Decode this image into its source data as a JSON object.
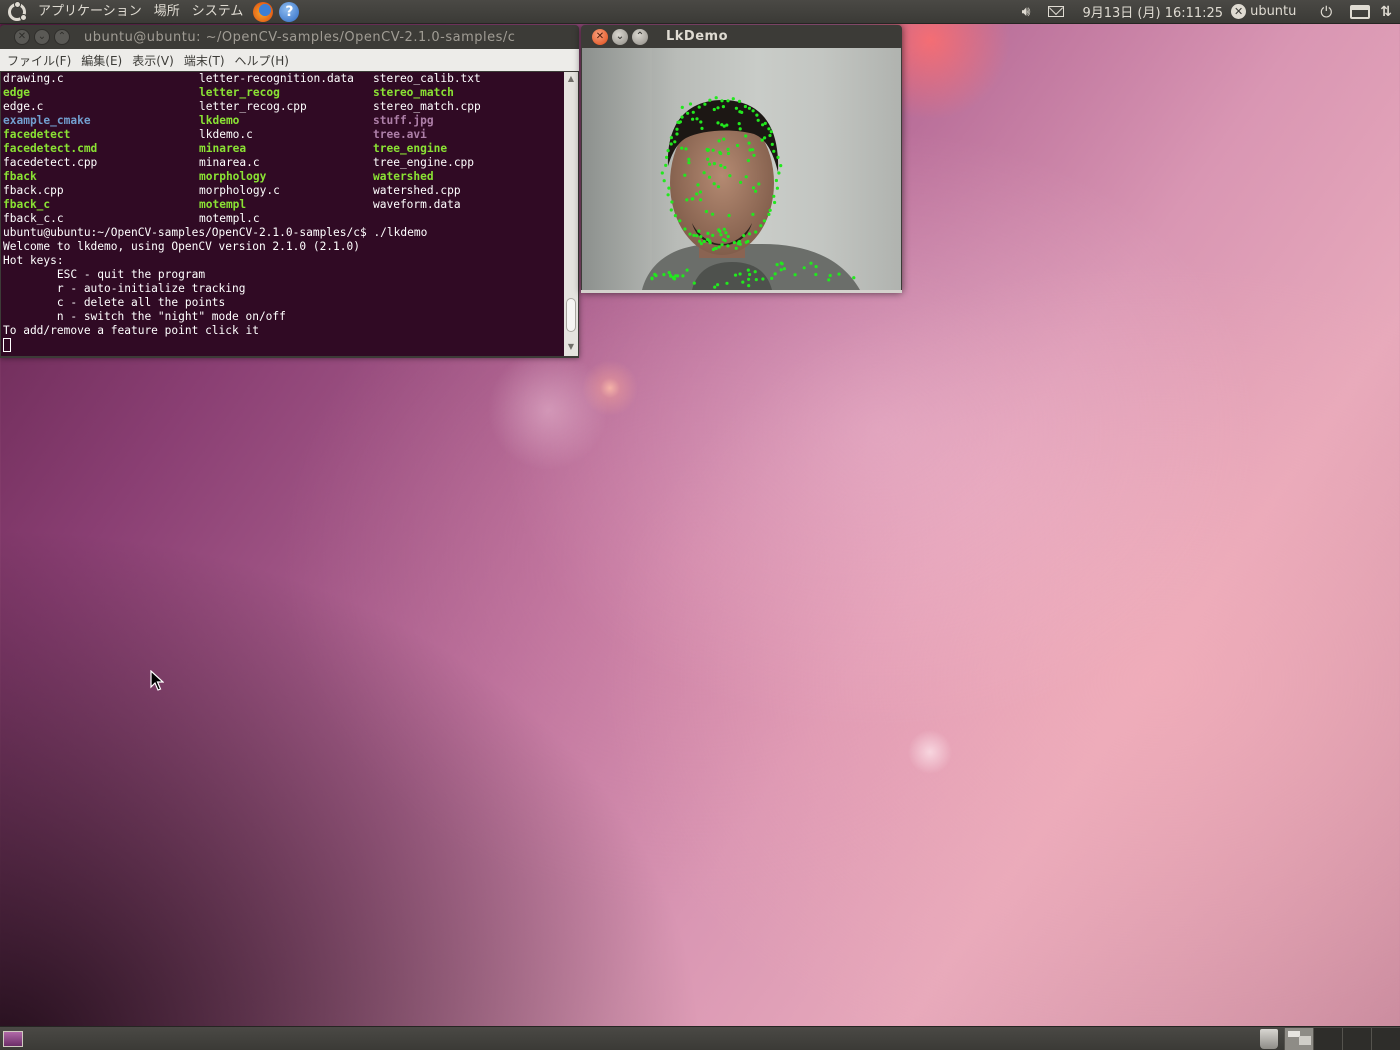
{
  "top_panel": {
    "menus": [
      "アプリケーション",
      "場所",
      "システム"
    ],
    "clock": "9月13日 (月) 16:11:25",
    "username": "ubuntu",
    "icons": [
      "ubuntu-logo-icon",
      "firefox-icon",
      "help-icon",
      "volume-icon",
      "mail-icon",
      "user-status-icon",
      "power-icon",
      "network-icon",
      "update-arrows-icon"
    ]
  },
  "terminal": {
    "title": "ubuntu@ubuntu: ~/OpenCV-samples/OpenCV-2.1.0-samples/c",
    "menus": [
      "ファイル(F)",
      "編集(E)",
      "表示(V)",
      "端末(T)",
      "ヘルプ(H)"
    ],
    "listing": [
      [
        {
          "t": "drawing.c",
          "k": "plain"
        },
        {
          "t": "letter-recognition.data",
          "k": "plain"
        },
        {
          "t": "stereo_calib.txt",
          "k": "plain"
        }
      ],
      [
        {
          "t": "edge",
          "k": "exe"
        },
        {
          "t": "letter_recog",
          "k": "exe"
        },
        {
          "t": "stereo_match",
          "k": "exe"
        }
      ],
      [
        {
          "t": "edge.c",
          "k": "plain"
        },
        {
          "t": "letter_recog.cpp",
          "k": "plain"
        },
        {
          "t": "stereo_match.cpp",
          "k": "plain"
        }
      ],
      [
        {
          "t": "example_cmake",
          "k": "dir"
        },
        {
          "t": "lkdemo",
          "k": "exe"
        },
        {
          "t": "stuff.jpg",
          "k": "media"
        }
      ],
      [
        {
          "t": "facedetect",
          "k": "exe"
        },
        {
          "t": "lkdemo.c",
          "k": "plain"
        },
        {
          "t": "tree.avi",
          "k": "media"
        }
      ],
      [
        {
          "t": "facedetect.cmd",
          "k": "exe"
        },
        {
          "t": "minarea",
          "k": "exe"
        },
        {
          "t": "tree_engine",
          "k": "exe"
        }
      ],
      [
        {
          "t": "facedetect.cpp",
          "k": "plain"
        },
        {
          "t": "minarea.c",
          "k": "plain"
        },
        {
          "t": "tree_engine.cpp",
          "k": "plain"
        }
      ],
      [
        {
          "t": "fback",
          "k": "exe"
        },
        {
          "t": "morphology",
          "k": "exe"
        },
        {
          "t": "watershed",
          "k": "exe"
        }
      ],
      [
        {
          "t": "fback.cpp",
          "k": "plain"
        },
        {
          "t": "morphology.c",
          "k": "plain"
        },
        {
          "t": "watershed.cpp",
          "k": "plain"
        }
      ],
      [
        {
          "t": "fback_c",
          "k": "exe"
        },
        {
          "t": "motempl",
          "k": "exe"
        },
        {
          "t": "waveform.data",
          "k": "plain"
        }
      ],
      [
        {
          "t": "fback_c.c",
          "k": "plain"
        },
        {
          "t": "motempl.c",
          "k": "plain"
        },
        {
          "t": "",
          "k": "plain"
        }
      ]
    ],
    "output": [
      "ubuntu@ubuntu:~/OpenCV-samples/OpenCV-2.1.0-samples/c$ ./lkdemo",
      "Welcome to lkdemo, using OpenCV version 2.1.0 (2.1.0)",
      "Hot keys:",
      "        ESC - quit the program",
      "        r - auto-initialize tracking",
      "        c - delete all the points",
      "        n - switch the \"night\" mode on/off",
      "To add/remove a feature point click it"
    ]
  },
  "lkdemo": {
    "title": "LkDemo",
    "point_color": "#22e81e"
  },
  "colors": {
    "terminal_bg": "#300a24",
    "executable": "#8ae234",
    "directory": "#729fcf",
    "media": "#ad7fa8",
    "close_button": "#df4a16"
  }
}
